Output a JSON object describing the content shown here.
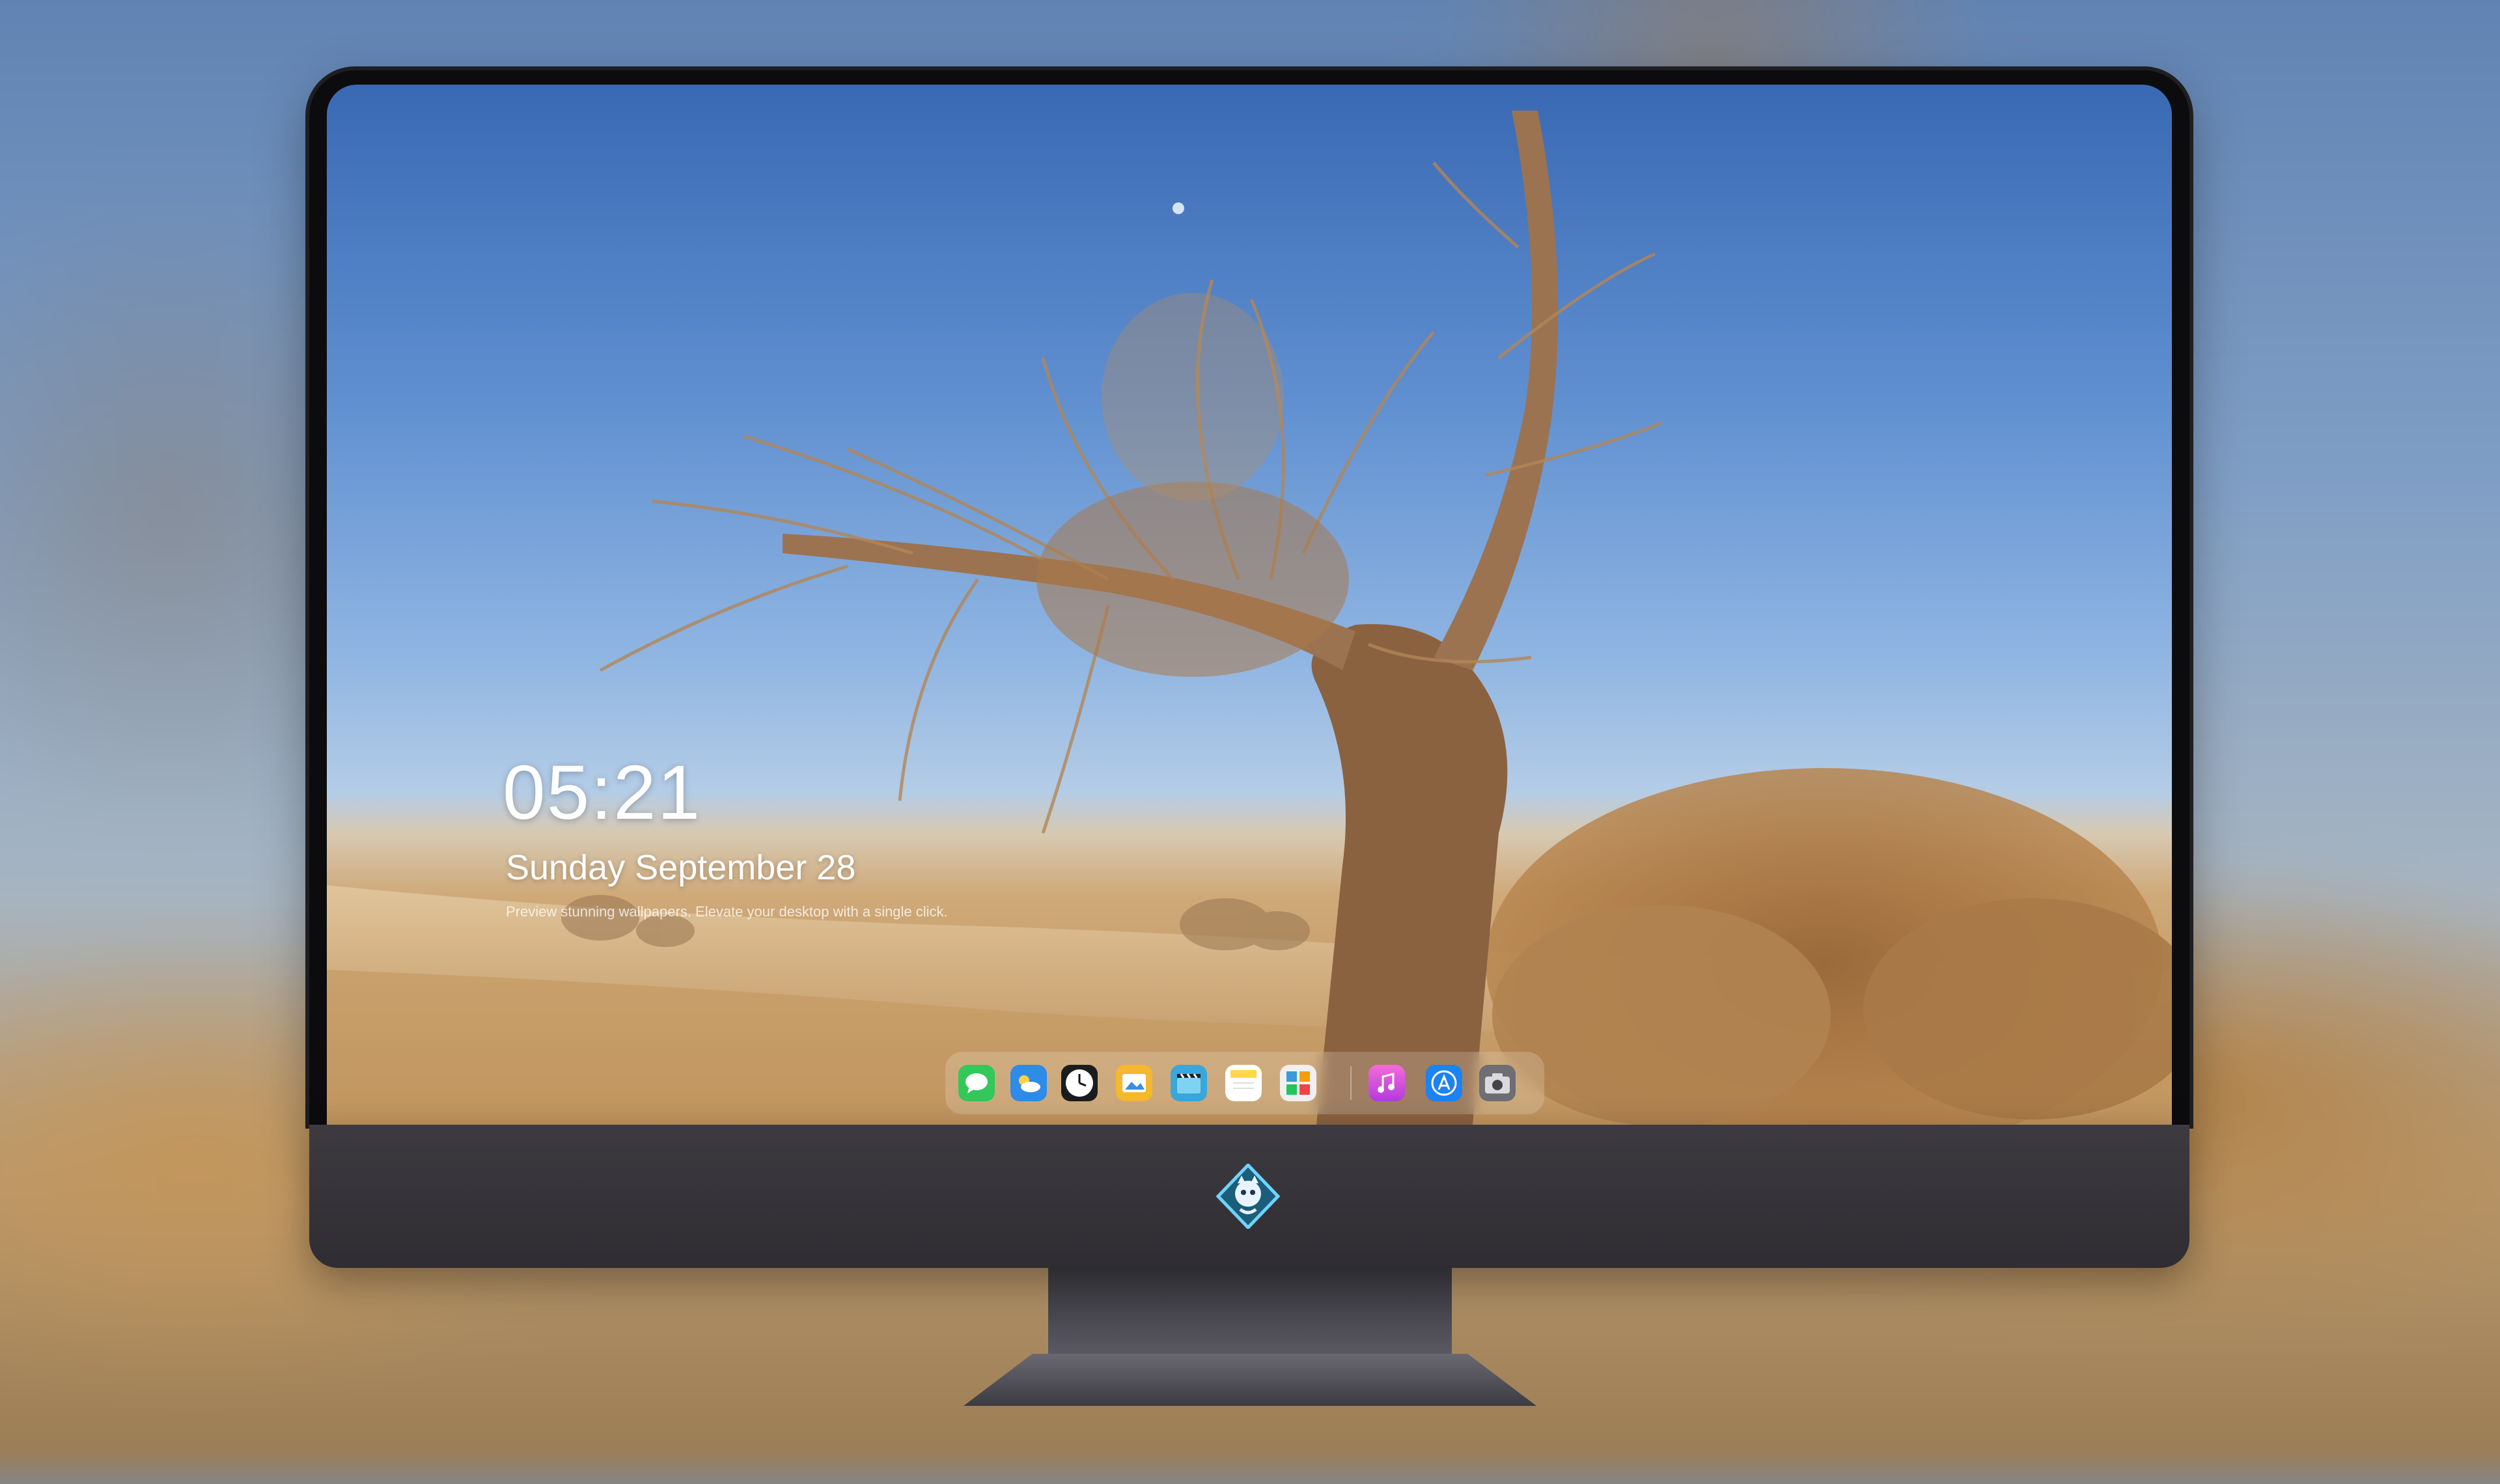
{
  "lockscreen": {
    "time": "05:21",
    "date": "Sunday September 28",
    "caption": "Preview stunning wallpapers. Elevate your desktop with a single click."
  },
  "dock": {
    "apps": [
      {
        "name": "messages-icon",
        "glyph": "💬",
        "color": "#34c759"
      },
      {
        "name": "weather-icon",
        "glyph": "☁",
        "color": "#2f8be8"
      },
      {
        "name": "clock-icon",
        "glyph": "🕓",
        "color": "#1c1c1e"
      },
      {
        "name": "preview-icon",
        "glyph": "🖼",
        "color": "#f5b82e"
      },
      {
        "name": "video-icon",
        "glyph": "🎬",
        "color": "#39a7d9"
      },
      {
        "name": "notes-icon",
        "glyph": "≡",
        "color": "#ffd84a"
      },
      {
        "name": "photos-icon",
        "glyph": "▦",
        "color": "#3b9ad9"
      },
      {
        "name": "music-icon",
        "glyph": "♫",
        "color": "#e14fd6"
      },
      {
        "name": "app-store-icon",
        "glyph": "Ⓐ",
        "color": "#1d82f2"
      },
      {
        "name": "camera-icon",
        "glyph": "📷",
        "color": "#6e6e73"
      }
    ]
  }
}
